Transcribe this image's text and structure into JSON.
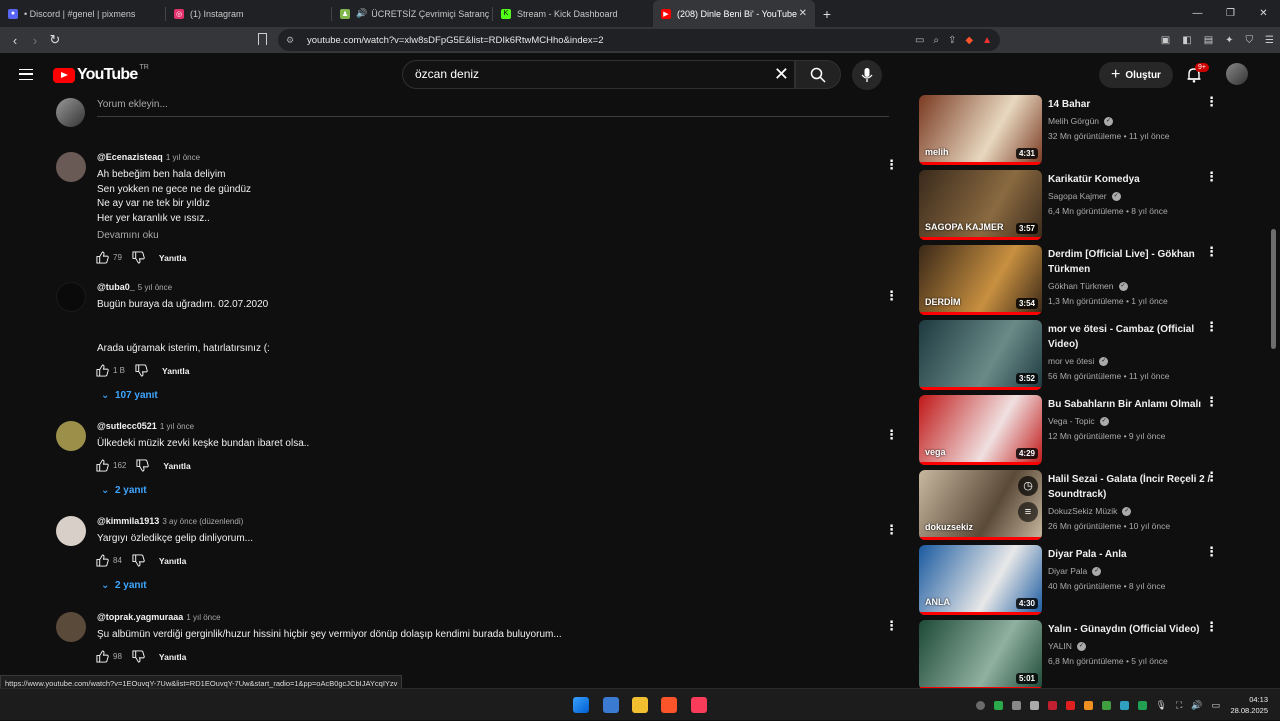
{
  "browser": {
    "tabs": [
      {
        "title": "• Discord | #genel | pixmens",
        "color": "#5865f2"
      },
      {
        "title": "(1) Instagram",
        "color": "#e1306c"
      },
      {
        "title": "ÜCRETSİZ Çevrimiçi Satranç Oyna",
        "color": "#81b64c"
      },
      {
        "title": "Stream - Kick Dashboard",
        "color": "#53fc18"
      },
      {
        "title": "(208) Dinle Beni Bi' - YouTube",
        "color": "#ff0000"
      }
    ],
    "new_tab": "+",
    "url": "youtube.com/watch?v=xlw8sDFpG5E&list=RDIk6RtwMCHho&index=2",
    "hover_url": "https://www.youtube.com/watch?v=1EOuvqY-7Uw&list=RD1EOuvqY-7Uw&start_radio=1&pp=oAcB0gcJCbIJAYcqIYzv"
  },
  "youtube": {
    "logo_word": "YouTube",
    "region": "TR",
    "search_value": "özcan deniz",
    "create_label": "Oluştur",
    "notif_badge": "9+"
  },
  "comments": {
    "add_placeholder": "Yorum ekleyin...",
    "items": [
      {
        "author": "@Ecenazisteaq",
        "time": "1 yıl önce",
        "lines": [
          "Ah bebeğim ben hala deliyim",
          "Sen yokken ne gece ne de gündüz",
          "Ne ay var ne tek bir yıldız",
          "Her yer karanlık ve ıssız.."
        ],
        "more": "Devamını oku",
        "likes": "79",
        "reply": "Yanıtla",
        "avatar": "#6a5a55"
      },
      {
        "author": "@tuba0_",
        "time": "5 yıl önce",
        "lines": [
          "Bugün buraya da uğradım. 02.07.2020",
          "",
          "",
          "Arada uğramak isterim, hatırlatırsınız (:"
        ],
        "likes": "1 B",
        "reply": "Yanıtla",
        "replies": "107 yanıt",
        "avatar": "#0a0a0a"
      },
      {
        "author": "@sutlecc0521",
        "time": "1 yıl önce",
        "lines": [
          "Ülkedeki müzik zevki keşke bundan ibaret olsa.."
        ],
        "likes": "162",
        "reply": "Yanıtla",
        "replies": "2 yanıt",
        "avatar": "#9c8f4a"
      },
      {
        "author": "@kimmila1913",
        "time": "3 ay önce (düzenlendi)",
        "lines": [
          "Yargıyı özledikçe gelip dinliyorum..."
        ],
        "likes": "84",
        "reply": "Yanıtla",
        "replies": "2 yanıt",
        "avatar": "#d8d0c8"
      },
      {
        "author": "@toprak.yagmuraaa",
        "time": "1 yıl önce",
        "lines": [
          "Şu albümün verdiği gerginlik/huzur hissini hiçbir şey vermiyor dönüp dolaşıp kendimi burada buluyorum..."
        ],
        "likes": "98",
        "reply": "Yanıtla",
        "avatar": "#5a4a3a"
      }
    ]
  },
  "sidebar": {
    "videos": [
      {
        "title": "14 Bahar",
        "channel": "Melih Görgün",
        "meta": "32 Mn görüntüleme • 11 yıl önce",
        "duration": "4:31",
        "thumb": "#7a3a22",
        "thumb2": "#e8d8c0",
        "thumb_text": "melih"
      },
      {
        "title": "Karikatür Komedya",
        "channel": "Sagopa Kajmer",
        "meta": "6,4 Mn görüntüleme • 8 yıl önce",
        "duration": "3:57",
        "thumb": "#3a2a1c",
        "thumb2": "#8a6a40",
        "thumb_text": "SAGOPA KAJMER"
      },
      {
        "title": "Derdim [Official Live] - Gökhan Türkmen",
        "channel": "Gökhan Türkmen",
        "meta": "1,3 Mn görüntüleme • 1 yıl önce",
        "duration": "3:54",
        "thumb": "#3a2818",
        "thumb2": "#c89040",
        "thumb_text": "DERDİM"
      },
      {
        "title": "mor ve ötesi - Cambaz (Official Video)",
        "channel": "mor ve ötesi",
        "meta": "56 Mn görüntüleme • 11 yıl önce",
        "duration": "3:52",
        "thumb": "#1e3a40",
        "thumb2": "#6a8a88",
        "thumb_text": ""
      },
      {
        "title": "Bu Sabahların Bir Anlamı Olmalı",
        "channel": "Vega - Topic",
        "meta": "12 Mn görüntüleme • 9 yıl önce",
        "duration": "4:29",
        "thumb": "#c01818",
        "thumb2": "#f0e0e0",
        "thumb_text": "vega"
      },
      {
        "title": "Halil Sezai - Galata (İncir Reçeli 2 / Soundtrack)",
        "channel": "DokuzSekiz Müzik",
        "meta": "26 Mn görüntüleme • 10 yıl önce",
        "duration": "",
        "thumb": "#c8b8a0",
        "thumb2": "#5a4a38",
        "thumb_text": "dokuzsekiz"
      },
      {
        "title": "Diyar Pala - Anla",
        "channel": "Diyar Pala",
        "meta": "40 Mn görüntüleme • 8 yıl önce",
        "duration": "4:30",
        "thumb": "#1a5aa0",
        "thumb2": "#e8e8e8",
        "thumb_text": "ANLA"
      },
      {
        "title": "Yalın - Günaydın (Official Video)",
        "channel": "YALIN",
        "meta": "6,8 Mn görüntüleme • 5 yıl önce",
        "duration": "5:01",
        "thumb": "#1e4a38",
        "thumb2": "#90b0a0",
        "thumb_text": ""
      }
    ]
  },
  "taskbar": {
    "time": "04:13",
    "date": "28.08.2025"
  }
}
